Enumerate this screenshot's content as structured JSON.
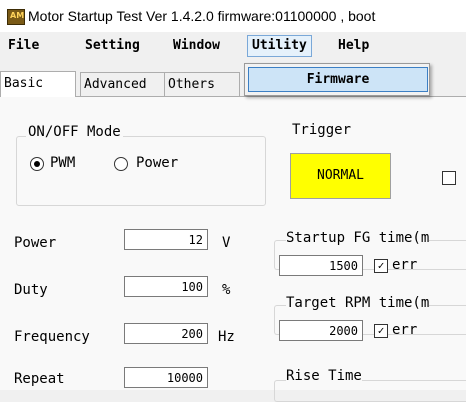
{
  "window": {
    "title": "Motor Startup Test Ver 1.4.2.0  firmware:01100000 , boot"
  },
  "menu": {
    "items": [
      "File",
      "Setting",
      "Window",
      "Utility",
      "Help"
    ],
    "open_menu": "Utility",
    "dropdown_items": [
      "Firmware"
    ]
  },
  "tabs": [
    "Basic",
    "Advanced",
    "Others"
  ],
  "active_tab": "Basic",
  "onoff": {
    "legend": "ON/OFF Mode",
    "options": [
      "PWM",
      "Power"
    ],
    "selected": "PWM"
  },
  "trigger": {
    "legend": "Trigger",
    "button_label": "NORMAL",
    "button_color": "#ffff00"
  },
  "params": [
    {
      "label": "Power",
      "value": "12",
      "unit": "V"
    },
    {
      "label": "Duty",
      "value": "100",
      "unit": "%"
    },
    {
      "label": "Frequency",
      "value": "200",
      "unit": "Hz"
    },
    {
      "label": "Repeat",
      "value": "10000",
      "unit": ""
    }
  ],
  "right_groups": [
    {
      "legend": "Startup FG time(m",
      "value": "1500",
      "check_label": "err"
    },
    {
      "legend": "Target RPM time(m",
      "value": "2000",
      "check_label": "err"
    },
    {
      "legend": "Rise Time"
    }
  ]
}
